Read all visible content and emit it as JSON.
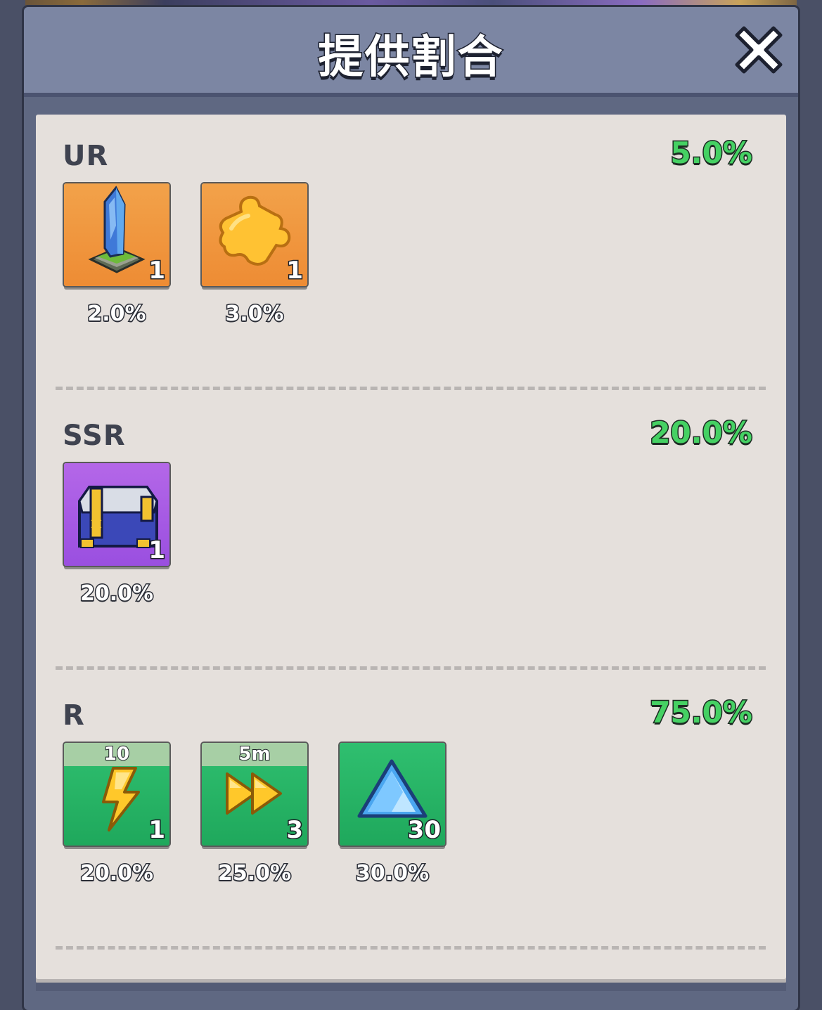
{
  "dialog": {
    "title": "提供割合"
  },
  "sections": [
    {
      "rarity": "UR",
      "total": "5.0%",
      "items": [
        {
          "icon": "crystal-obelisk-icon",
          "qty": "1",
          "pct": "2.0%"
        },
        {
          "icon": "puzzle-piece-icon",
          "qty": "1",
          "pct": "3.0%"
        }
      ]
    },
    {
      "rarity": "SSR",
      "total": "20.0%",
      "items": [
        {
          "icon": "supply-chest-icon",
          "qty": "1",
          "pct": "20.0%"
        }
      ]
    },
    {
      "rarity": "R",
      "total": "75.0%",
      "items": [
        {
          "icon": "lightning-bolt-icon",
          "top": "10",
          "qty": "1",
          "pct": "20.0%"
        },
        {
          "icon": "fast-forward-icon",
          "top": "5m",
          "qty": "3",
          "pct": "25.0%"
        },
        {
          "icon": "blue-gem-icon",
          "qty": "30",
          "pct": "30.0%"
        }
      ]
    }
  ],
  "colors": {
    "accent_green": "#45d163",
    "ur_tile": "#ee8c34",
    "ssr_tile": "#9a4fe0",
    "r_tile": "#1fa85c"
  }
}
